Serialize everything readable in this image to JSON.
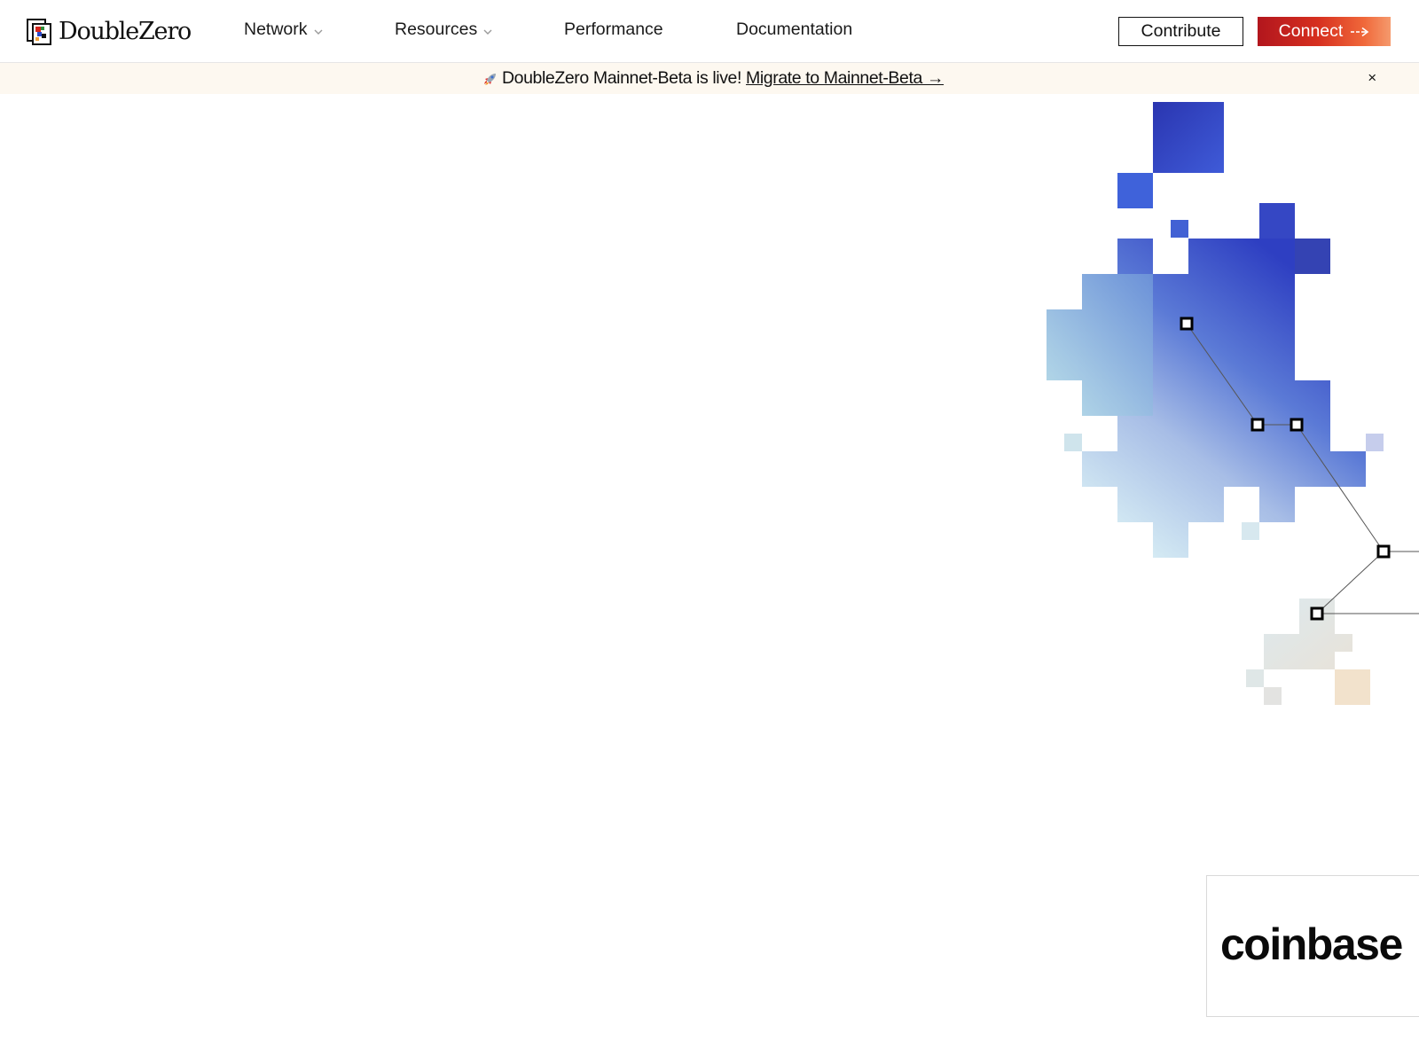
{
  "brand": {
    "name": "DoubleZero",
    "logo_icon": "doublezero-logo-icon"
  },
  "nav": {
    "items": [
      {
        "label": "Network",
        "has_dropdown": true
      },
      {
        "label": "Resources",
        "has_dropdown": true
      },
      {
        "label": "Performance",
        "has_dropdown": false
      },
      {
        "label": "Documentation",
        "has_dropdown": false
      }
    ],
    "contribute_label": "Contribute",
    "connect_label": "Connect"
  },
  "banner": {
    "icon": "rocket-icon",
    "text": "DoubleZero Mainnet-Beta is live!",
    "link_text": "Migrate to Mainnet-Beta →",
    "close_label": "×"
  },
  "partners": {
    "visible": [
      "coinbase"
    ]
  },
  "colors": {
    "accent_red": "#c41e1e",
    "accent_orange": "#f59a6d",
    "banner_bg": "#fdf8f0",
    "art_blue": "#3a4fc9",
    "art_light": "#cfe6f0"
  }
}
